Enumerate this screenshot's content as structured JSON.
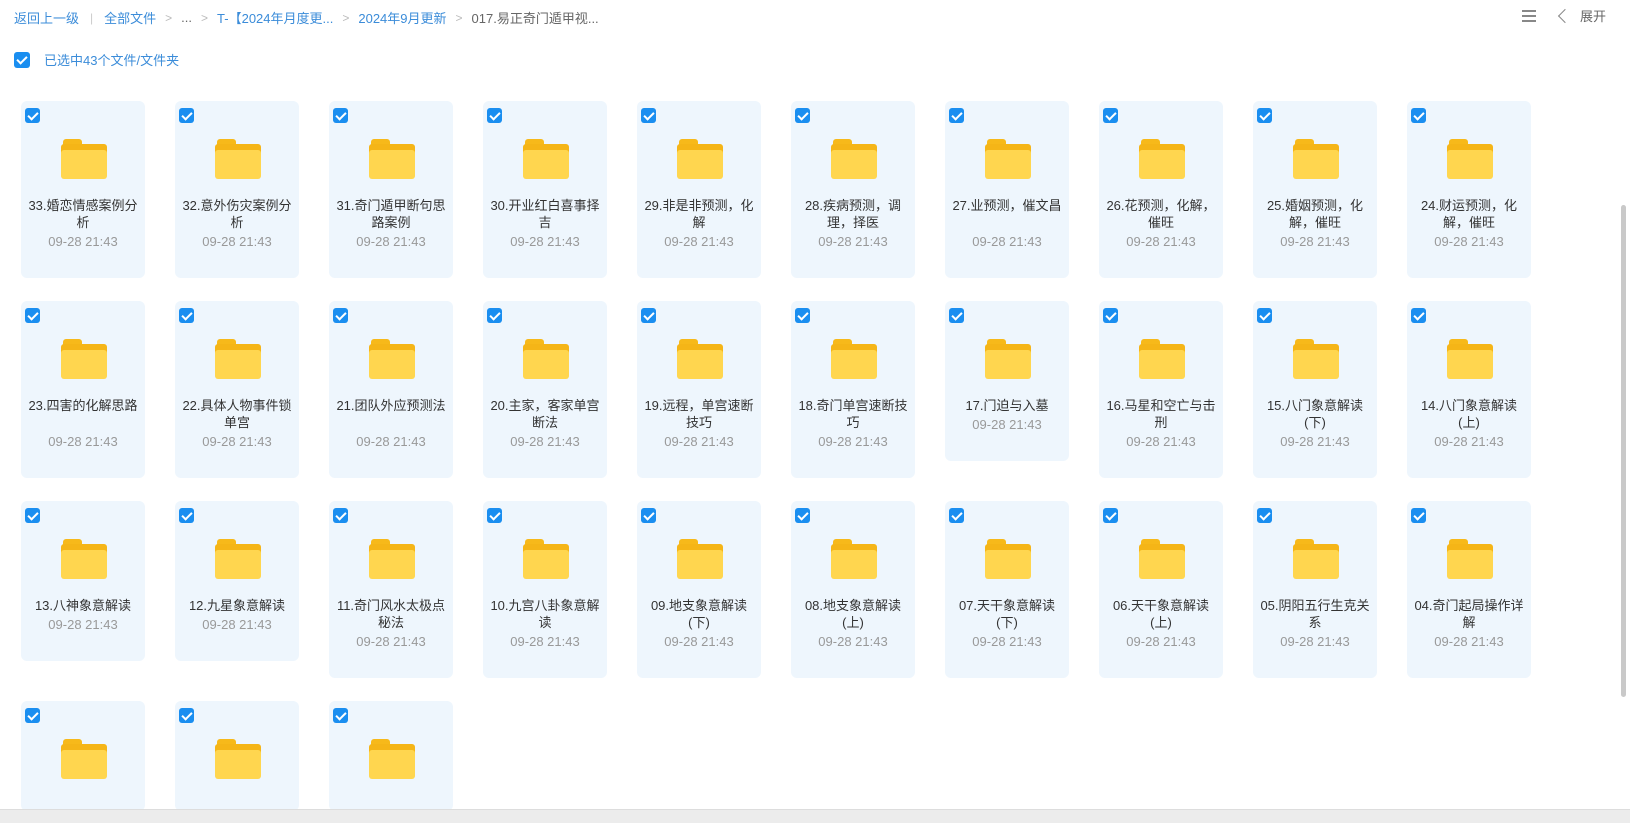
{
  "breadcrumb": {
    "back": "返回上一级",
    "items": [
      "全部文件",
      "...",
      "T-【2024年月度更...",
      "2024年9月更新",
      "017.易正奇门遁甲视..."
    ]
  },
  "topbar": {
    "expand_label": "展开"
  },
  "selection": {
    "label": "已选中43个文件/文件夹"
  },
  "files": [
    {
      "name": "33.婚恋情感案例分析",
      "date": "09-28 21:43"
    },
    {
      "name": "32.意外伤灾案例分析",
      "date": "09-28 21:43"
    },
    {
      "name": "31.奇门遁甲断句思路案例",
      "date": "09-28 21:43"
    },
    {
      "name": "30.开业红白喜事择吉",
      "date": "09-28 21:43"
    },
    {
      "name": "29.非是非预测，化解",
      "date": "09-28 21:43"
    },
    {
      "name": "28.疾病预测，调理，择医",
      "date": "09-28 21:43"
    },
    {
      "name": "27.业预测，催文昌",
      "date": "09-28 21:43"
    },
    {
      "name": "26.花预测，化解，催旺",
      "date": "09-28 21:43"
    },
    {
      "name": "25.婚姻预测，化解，催旺",
      "date": "09-28 21:43"
    },
    {
      "name": "24.财运预测，化解，催旺",
      "date": "09-28 21:43"
    },
    {
      "name": "23.四害的化解思路",
      "date": "09-28 21:43"
    },
    {
      "name": "22.具体人物事件锁单宫",
      "date": "09-28 21:43"
    },
    {
      "name": "21.团队外应预测法",
      "date": "09-28 21:43"
    },
    {
      "name": "20.主家，客家单宫断法",
      "date": "09-28 21:43"
    },
    {
      "name": "19.远程，单宫速断技巧",
      "date": "09-28 21:43"
    },
    {
      "name": "18.奇门单宫速断技巧",
      "date": "09-28 21:43"
    },
    {
      "name": "17.门迫与入墓",
      "date": "09-28 21:43"
    },
    {
      "name": "16.马星和空亡与击刑",
      "date": "09-28 21:43"
    },
    {
      "name": "15.八门象意解读(下)",
      "date": "09-28 21:43"
    },
    {
      "name": "14.八门象意解读(上)",
      "date": "09-28 21:43"
    },
    {
      "name": "13.八神象意解读",
      "date": "09-28 21:43"
    },
    {
      "name": "12.九星象意解读",
      "date": "09-28 21:43"
    },
    {
      "name": "11.奇门风水太极点秘法",
      "date": "09-28 21:43"
    },
    {
      "name": "10.九宫八卦象意解读",
      "date": "09-28 21:43"
    },
    {
      "name": "09.地支象意解读(下)",
      "date": "09-28 21:43"
    },
    {
      "name": "08.地支象意解读(上)",
      "date": "09-28 21:43"
    },
    {
      "name": "07.天干象意解读(下)",
      "date": "09-28 21:43"
    },
    {
      "name": "06.天干象意解读(上)",
      "date": "09-28 21:43"
    },
    {
      "name": "05.阴阳五行生克关系",
      "date": "09-28 21:43"
    },
    {
      "name": "04.奇门起局操作详解",
      "date": "09-28 21:43"
    },
    {
      "name": "",
      "date": ""
    },
    {
      "name": "",
      "date": ""
    },
    {
      "name": "",
      "date": ""
    }
  ]
}
